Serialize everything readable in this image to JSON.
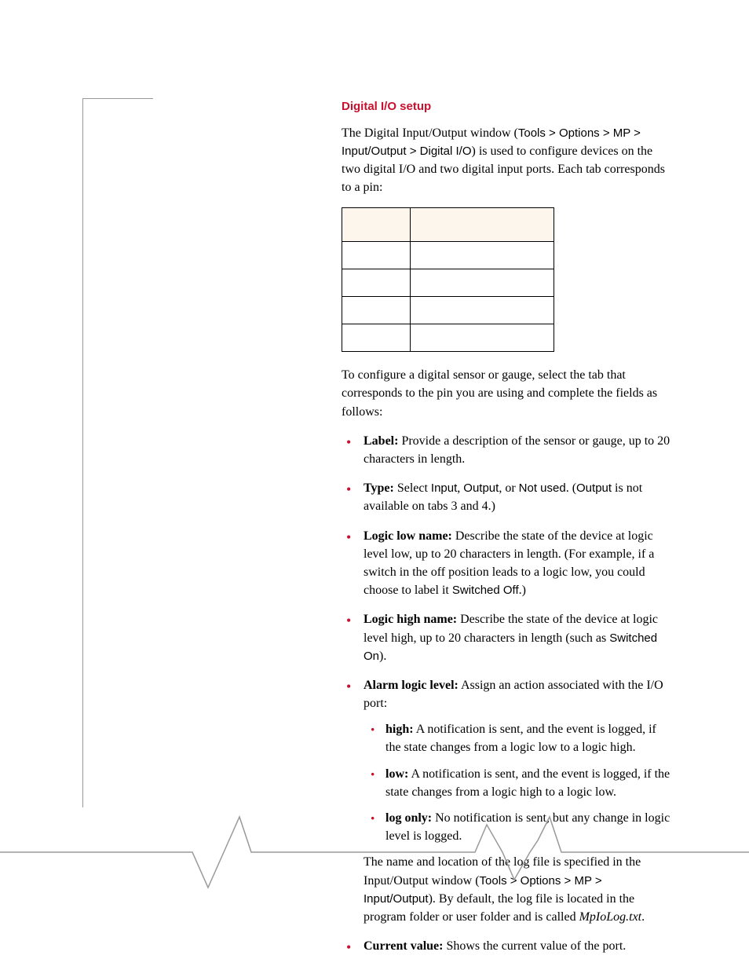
{
  "section_title": "Digital I/O setup",
  "intro_pre": "The Digital Input/Output window (",
  "intro_path": "Tools > Options > MP > Input/Output > Digital I/O",
  "intro_post": ") is used to configure devices on the two digital I/O and two digital input ports. Each tab corresponds to a pin:",
  "table": {
    "headers": [
      "",
      ""
    ],
    "rows": [
      [
        "",
        ""
      ],
      [
        "",
        ""
      ],
      [
        "",
        ""
      ],
      [
        "",
        ""
      ]
    ]
  },
  "after_table": "To configure a digital sensor or gauge, select the tab that corresponds to the pin you are using and complete the fields as follows:",
  "bullets": {
    "label_b": "Label:",
    "label_t": " Provide a description of the sensor or gauge, up to 20 characters in length.",
    "type_b": "Type:",
    "type_t1": " Select ",
    "type_s1": "Input",
    "type_t2": ", ",
    "type_s2": "Output",
    "type_t3": ", or ",
    "type_s3": "Not used",
    "type_t4": ". (",
    "type_s4": "Output",
    "type_t5": " is not available on tabs 3 and 4.)",
    "low_b": "Logic low name:",
    "low_t1": " Describe the state of the device at logic level low, up to 20 characters in length. (For example, if a switch in the off position leads to a logic low, you could choose to label it ",
    "low_s1": "Switched Off",
    "low_t2": ".)",
    "high_b": "Logic high name:",
    "high_t1": " Describe the state of the device at logic level high, up to 20 characters in length (such as ",
    "high_s1": "Switched On",
    "high_t2": ").",
    "alarm_b": "Alarm logic level:",
    "alarm_t": " Assign an action associated with the I/O port:",
    "sub_high_b": "high:",
    "sub_high_t": " A notification is sent, and the event is logged, if the state changes from a logic low to a logic high.",
    "sub_low_b": "low:",
    "sub_low_t": " A notification is sent, and the event is logged, if the state changes from a logic high to a logic low.",
    "sub_log_b": "log only:",
    "sub_log_t": " No notification is sent, but any change in logic level is logged.",
    "log_para_1": "The name and location of the log file is specified in the Input/Output window (",
    "log_para_path": "Tools > Options > MP > Input/Output",
    "log_para_2": "). By default, the log file is located in the program folder or user folder and is called ",
    "log_para_file": "MpIoLog.txt",
    "log_para_3": ".",
    "current_b": "Current value:",
    "current_t": " Shows the current value of the port."
  }
}
